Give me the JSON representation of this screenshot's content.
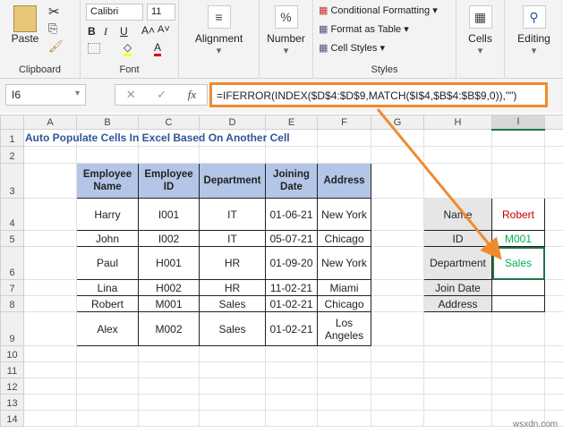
{
  "ribbon": {
    "clipboard": {
      "paste": "Paste",
      "label": "Clipboard"
    },
    "font": {
      "name": "Calibri",
      "size": "11",
      "bold": "B",
      "italic": "I",
      "underline": "U",
      "grow": "A˄",
      "shrink": "A˅",
      "fill": "◇",
      "color": "A",
      "label": "Font"
    },
    "alignment": {
      "label": "Alignment",
      "icon": "≡"
    },
    "number": {
      "label": "Number",
      "icon": "%"
    },
    "styles": {
      "conditional": "Conditional Formatting",
      "table": "Format as Table",
      "cell": "Cell Styles",
      "label": "Styles"
    },
    "cells": {
      "label": "Cells"
    },
    "editing": {
      "label": "Editing"
    }
  },
  "formula_bar": {
    "name_box": "I6",
    "cancel": "✕",
    "enter": "✓",
    "fx": "fx",
    "formula": "=IFERROR(INDEX($D$4:$D$9,MATCH($I$4,$B$4:$B$9,0)),\"\")"
  },
  "columns": [
    "A",
    "B",
    "C",
    "D",
    "E",
    "F",
    "G",
    "H",
    "I"
  ],
  "rows": [
    "1",
    "2",
    "3",
    "4",
    "5",
    "6",
    "7",
    "8",
    "9",
    "10",
    "11",
    "12",
    "13",
    "14"
  ],
  "title": "Auto Populate Cells In Excel Based On Another Cell",
  "table": {
    "headers": [
      "Employee Name",
      "Employee ID",
      "Department",
      "Joining Date",
      "Address"
    ],
    "rows": [
      [
        "Harry",
        "I001",
        "IT",
        "01-06-21",
        "New York"
      ],
      [
        "John",
        "I002",
        "IT",
        "05-07-21",
        "Chicago"
      ],
      [
        "Paul",
        "H001",
        "HR",
        "01-09-20",
        "New York"
      ],
      [
        "Lina",
        "H002",
        "HR",
        "11-02-21",
        "Miami"
      ],
      [
        "Robert",
        "M001",
        "Sales",
        "01-02-21",
        "Chicago"
      ],
      [
        "Alex",
        "M002",
        "Sales",
        "01-02-21",
        "Los Angeles"
      ]
    ]
  },
  "lookup": {
    "labels": [
      "Name",
      "ID",
      "Department",
      "Join Date",
      "Address"
    ],
    "values": [
      "Robert",
      "M001",
      "Sales",
      "",
      ""
    ]
  },
  "colors": {
    "accent": "#f08a2c",
    "header_fill": "#b4c6e7",
    "title": "#2f5597",
    "name_value": "#c00000",
    "result_value": "#00b050"
  },
  "watermark": "wsxdn.com"
}
